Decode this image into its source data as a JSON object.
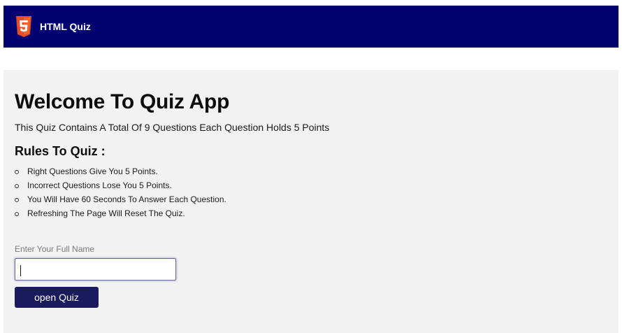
{
  "header": {
    "logo_icon": "html5-icon",
    "title": "HTML Quiz",
    "background_color": "#020270"
  },
  "main": {
    "title": "Welcome To Quiz App",
    "subtitle": "This Quiz Contains A Total Of 9 Questions Each Question Holds 5 Points",
    "rules_heading": "Rules To Quiz :",
    "rules": [
      "Right Questions Give You 5 Points.",
      "Incorrect Questions Lose You 5 Points.",
      "You Will Have 60 Seconds To Answer Each Question.",
      "Refreshing The Page Will Reset The Quiz."
    ],
    "name_label": "Enter Your Full Name",
    "name_value": "",
    "open_button_label": "open Quiz",
    "button_color": "#1a1a5e"
  }
}
